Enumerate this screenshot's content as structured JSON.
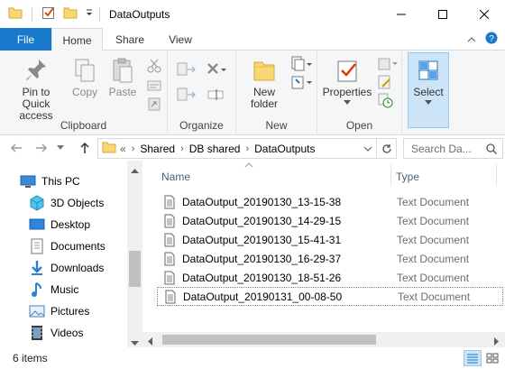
{
  "window": {
    "title": "DataOutputs",
    "minimize_icon": "minimize-icon",
    "maximize_icon": "maximize-icon",
    "close_icon": "close-icon"
  },
  "ribbon_tabs": {
    "file": "File",
    "home": "Home",
    "share": "Share",
    "view": "View"
  },
  "ribbon": {
    "clipboard": {
      "label": "Clipboard",
      "pin": "Pin to Quick access",
      "copy": "Copy",
      "paste": "Paste"
    },
    "organize": {
      "label": "Organize"
    },
    "new": {
      "label": "New",
      "new_folder": "New folder"
    },
    "open": {
      "label": "Open",
      "properties": "Properties"
    },
    "select": {
      "label": "Select"
    }
  },
  "address": {
    "overflow": "«",
    "crumbs": [
      "Shared",
      "DB shared",
      "DataOutputs"
    ],
    "search_placeholder": "Search Da..."
  },
  "nav_pane": {
    "items": [
      {
        "label": "This PC",
        "icon": "this-pc-icon"
      },
      {
        "label": "3D Objects",
        "icon": "3d-objects-icon"
      },
      {
        "label": "Desktop",
        "icon": "desktop-icon"
      },
      {
        "label": "Documents",
        "icon": "documents-icon"
      },
      {
        "label": "Downloads",
        "icon": "downloads-icon"
      },
      {
        "label": "Music",
        "icon": "music-icon"
      },
      {
        "label": "Pictures",
        "icon": "pictures-icon"
      },
      {
        "label": "Videos",
        "icon": "videos-icon"
      }
    ]
  },
  "file_list": {
    "columns": {
      "name": "Name",
      "type": "Type"
    },
    "rows": [
      {
        "name": "DataOutput_20190130_13-15-38",
        "type": "Text Document"
      },
      {
        "name": "DataOutput_20190130_14-29-15",
        "type": "Text Document"
      },
      {
        "name": "DataOutput_20190130_15-41-31",
        "type": "Text Document"
      },
      {
        "name": "DataOutput_20190130_16-29-37",
        "type": "Text Document"
      },
      {
        "name": "DataOutput_20190130_18-51-26",
        "type": "Text Document"
      },
      {
        "name": "DataOutput_20190131_00-08-50",
        "type": "Text Document"
      }
    ]
  },
  "status": {
    "item_count": "6 items"
  },
  "colors": {
    "accent": "#1979ca",
    "selection": "#cce4f7",
    "folder": "#f8d775"
  }
}
